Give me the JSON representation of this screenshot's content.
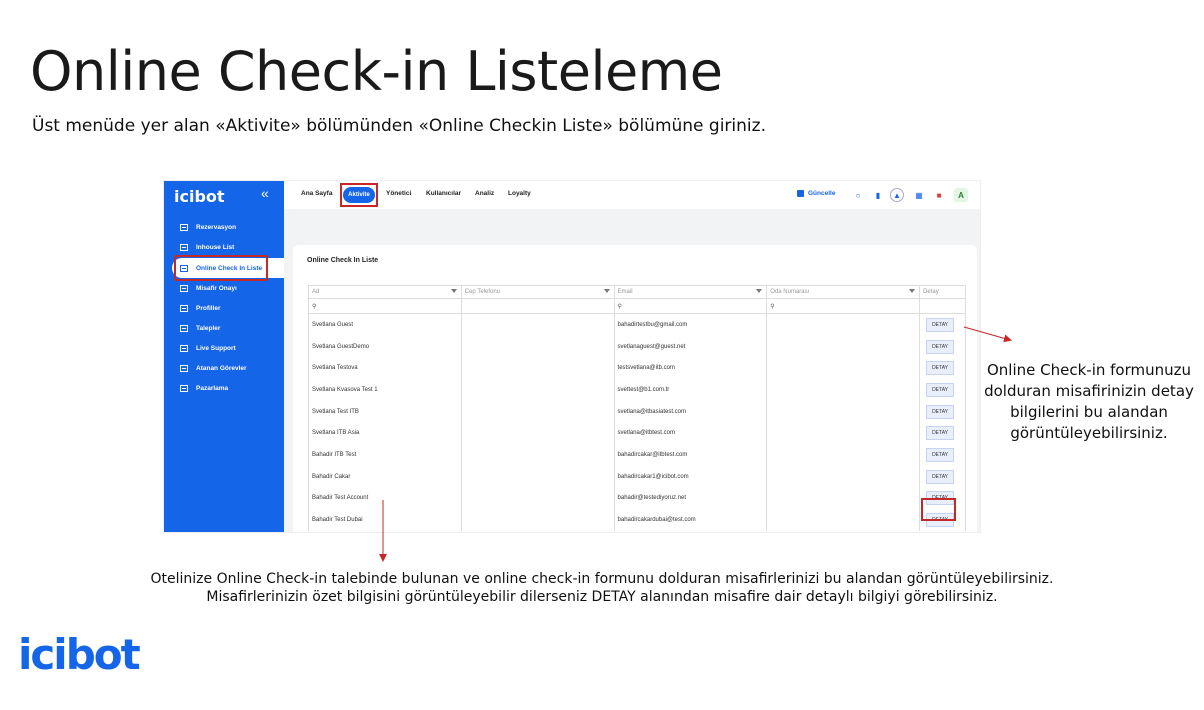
{
  "slide": {
    "title": "Online Check-in Listeleme",
    "subtitle": "Üst menüde yer alan «Aktivite» bölümünden «Online Checkin Liste» bölümüne giriniz."
  },
  "sidebar": {
    "logo": "icibot",
    "collapse": "«",
    "items": [
      {
        "label": "Rezervasyon"
      },
      {
        "label": "Inhouse List"
      },
      {
        "label": "Online Check In Liste"
      },
      {
        "label": "Misafir Onayı"
      },
      {
        "label": "Profiller"
      },
      {
        "label": "Talepler"
      },
      {
        "label": "Live Support"
      },
      {
        "label": "Atanan Görevler"
      },
      {
        "label": "Pazarlama"
      }
    ]
  },
  "topnav": {
    "items": [
      "Ana Sayfa",
      "Aktivite",
      "Yönetici",
      "Kullanıcılar",
      "Analiz",
      "Loyalty"
    ],
    "update_label": "Güncelle",
    "avatar": "A"
  },
  "card": {
    "title": "Online Check In Liste",
    "columns": [
      "Ad",
      "Cep Telefonu",
      "Email",
      "Oda Numarası",
      "Detay"
    ],
    "rows": [
      {
        "name": "Svetlana Guest",
        "email": "bahadirtestbu@gmail.com"
      },
      {
        "name": "Svetlana GuestDemo",
        "email": "svetlanaguest@guest.net"
      },
      {
        "name": "Svetlana Testova",
        "email": "testsvetlana@itb.com"
      },
      {
        "name": "Svetlana Kvasova Test 1",
        "email": "svettest@b1.com.tr"
      },
      {
        "name": "Svetlana Test ITB",
        "email": "svetlana@itbasiatest.com"
      },
      {
        "name": "Svetlana ITB Asia",
        "email": "svetlana@itbtest.com"
      },
      {
        "name": "Bahadir ITB Test",
        "email": "bahadircakar@itbtest.com"
      },
      {
        "name": "Bahadir Cakar",
        "email": "bahadircakar1@icibot.com"
      },
      {
        "name": "Bahadir Test Account",
        "email": "bahadir@testediyoruz.net"
      },
      {
        "name": "Bahadir Test Dubai",
        "email": "bahadircakardubai@test.com"
      }
    ],
    "detay_label": "DETAY"
  },
  "callouts": {
    "right": "Online Check-in formunuzu dolduran misafirinizin detay bilgilerini bu alandan görüntüleyebilirsiniz.",
    "bottom": "Otelinize Online Check-in talebinde bulunan ve online check-in formunu dolduran misafirlerinizi bu alandan görüntüleyebilirsiniz. Misafirlerinizin özet bilgisini görüntüleyebilir dilerseniz DETAY alanından misafire dair detaylı bilgiyi görebilirsiniz."
  },
  "footer_logo": "icibot",
  "colors": {
    "brand": "#1565e8",
    "highlight": "#c62828"
  }
}
